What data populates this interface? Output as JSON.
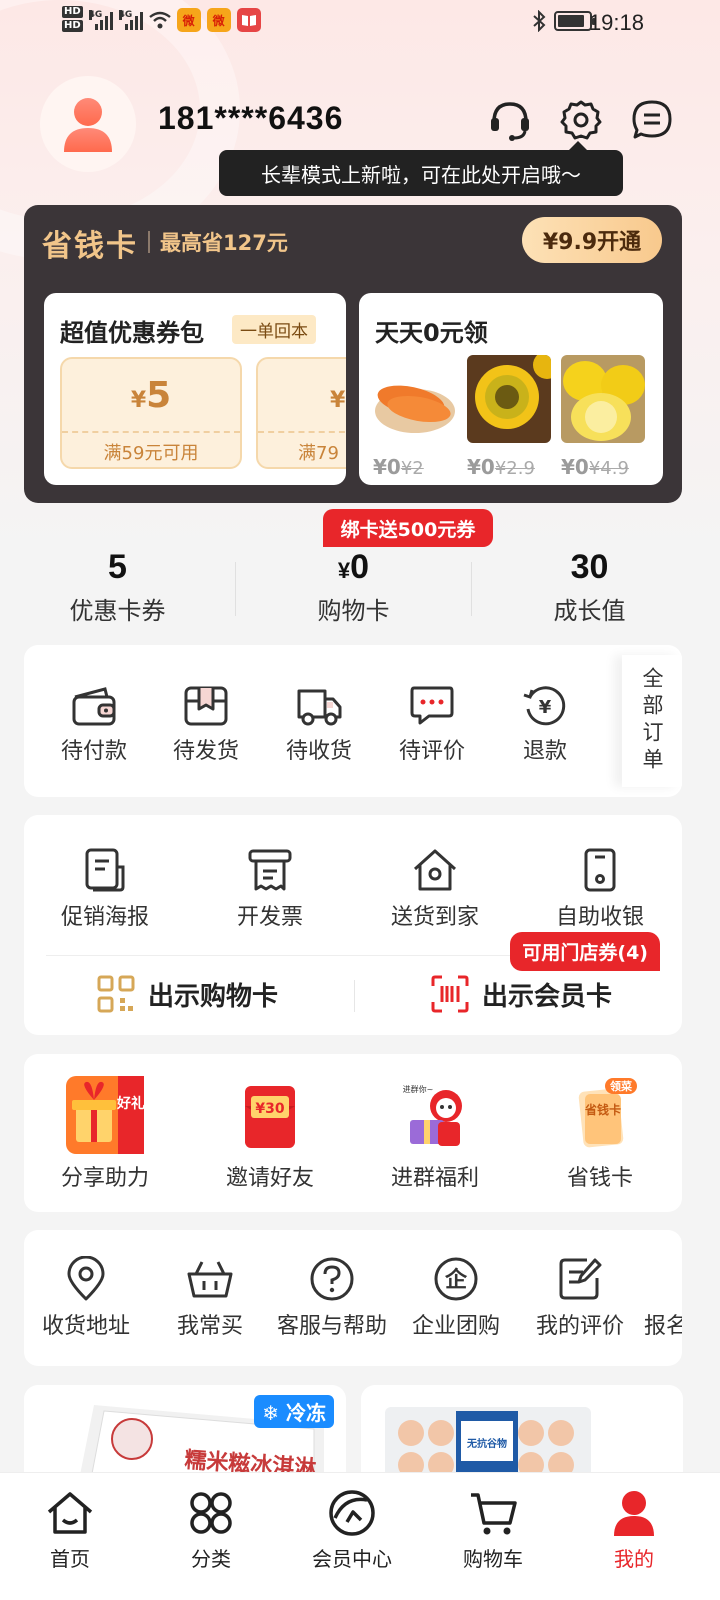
{
  "status_bar": {
    "hd1": "HD",
    "hd2": "HD",
    "net1": "4G",
    "net2": "4G",
    "weibo": "微",
    "time": "19:18",
    "battery_level": 0.85
  },
  "header": {
    "phone": "181****6436",
    "tooltip": "长辈模式上新啦，可在此处开启哦～"
  },
  "savings_card": {
    "title": "省钱卡",
    "subtitle": "最高省127元",
    "open_button": "¥9.9开通",
    "coupon_pack": {
      "title": "超值优惠券包",
      "tag": "一单回本",
      "coupons": [
        {
          "currency": "¥",
          "amount": "5",
          "condition": "满59元可用"
        },
        {
          "currency": "¥",
          "amount": "",
          "condition": "满79"
        }
      ]
    },
    "free_daily": {
      "title": "天天0元领",
      "items": [
        {
          "name": "carrot",
          "price": "¥0",
          "original": "¥2"
        },
        {
          "name": "passion-fruit",
          "price": "¥0",
          "original": "¥2.9"
        },
        {
          "name": "lemon",
          "price": "¥0",
          "original": "¥4.9"
        }
      ]
    }
  },
  "bind_badge": "绑卡送500元券",
  "stats": [
    {
      "value": "5",
      "label": "优惠卡券"
    },
    {
      "currency": "¥",
      "value": "0",
      "label": "购物卡"
    },
    {
      "value": "30",
      "label": "成长值"
    }
  ],
  "orders": {
    "items": [
      {
        "label": "待付款",
        "icon": "wallet-icon"
      },
      {
        "label": "待发货",
        "icon": "box-icon"
      },
      {
        "label": "待收货",
        "icon": "truck-icon"
      },
      {
        "label": "待评价",
        "icon": "chat-icon"
      },
      {
        "label": "退款",
        "icon": "refund-icon"
      }
    ],
    "all_orders": "全部订单"
  },
  "services": {
    "items": [
      {
        "label": "促销海报",
        "icon": "poster-icon"
      },
      {
        "label": "开发票",
        "icon": "invoice-icon"
      },
      {
        "label": "送货到家",
        "icon": "home-delivery-icon"
      },
      {
        "label": "自助收银",
        "icon": "phone-checkout-icon"
      }
    ],
    "show_shopping_card": "出示购物卡",
    "show_member_card": "出示会员卡",
    "store_coupon_badge": "可用门店券(4)"
  },
  "promos": {
    "items": [
      {
        "label": "分享助力",
        "img_text": "好礼"
      },
      {
        "label": "邀请好友",
        "img_text": "¥30"
      },
      {
        "label": "进群福利",
        "img_text": "进群你~"
      },
      {
        "label": "省钱卡",
        "img_text": "省钱卡",
        "badge": "领菜"
      }
    ]
  },
  "tools": {
    "items": [
      {
        "label": "收货地址",
        "icon": "location-pin-icon"
      },
      {
        "label": "我常买",
        "icon": "basket-icon"
      },
      {
        "label": "客服与帮助",
        "icon": "help-icon"
      },
      {
        "label": "企业团购",
        "icon": "enterprise-icon"
      },
      {
        "label": "我的评价",
        "icon": "review-icon"
      },
      {
        "label": "报名",
        "icon": ""
      }
    ]
  },
  "products": {
    "left": {
      "badge": "冷冻",
      "text": "糯米糍冰淇淋"
    },
    "right": {
      "text": "无抗谷物"
    }
  },
  "bottom_nav": [
    {
      "label": "首页",
      "icon": "home-icon"
    },
    {
      "label": "分类",
      "icon": "category-icon"
    },
    {
      "label": "会员中心",
      "icon": "member-icon"
    },
    {
      "label": "购物车",
      "icon": "cart-icon"
    },
    {
      "label": "我的",
      "icon": "profile-icon",
      "active": true
    }
  ],
  "colors": {
    "accent": "#e8262a",
    "gold": "#f1c58a",
    "dark_card": "#3b3538"
  }
}
